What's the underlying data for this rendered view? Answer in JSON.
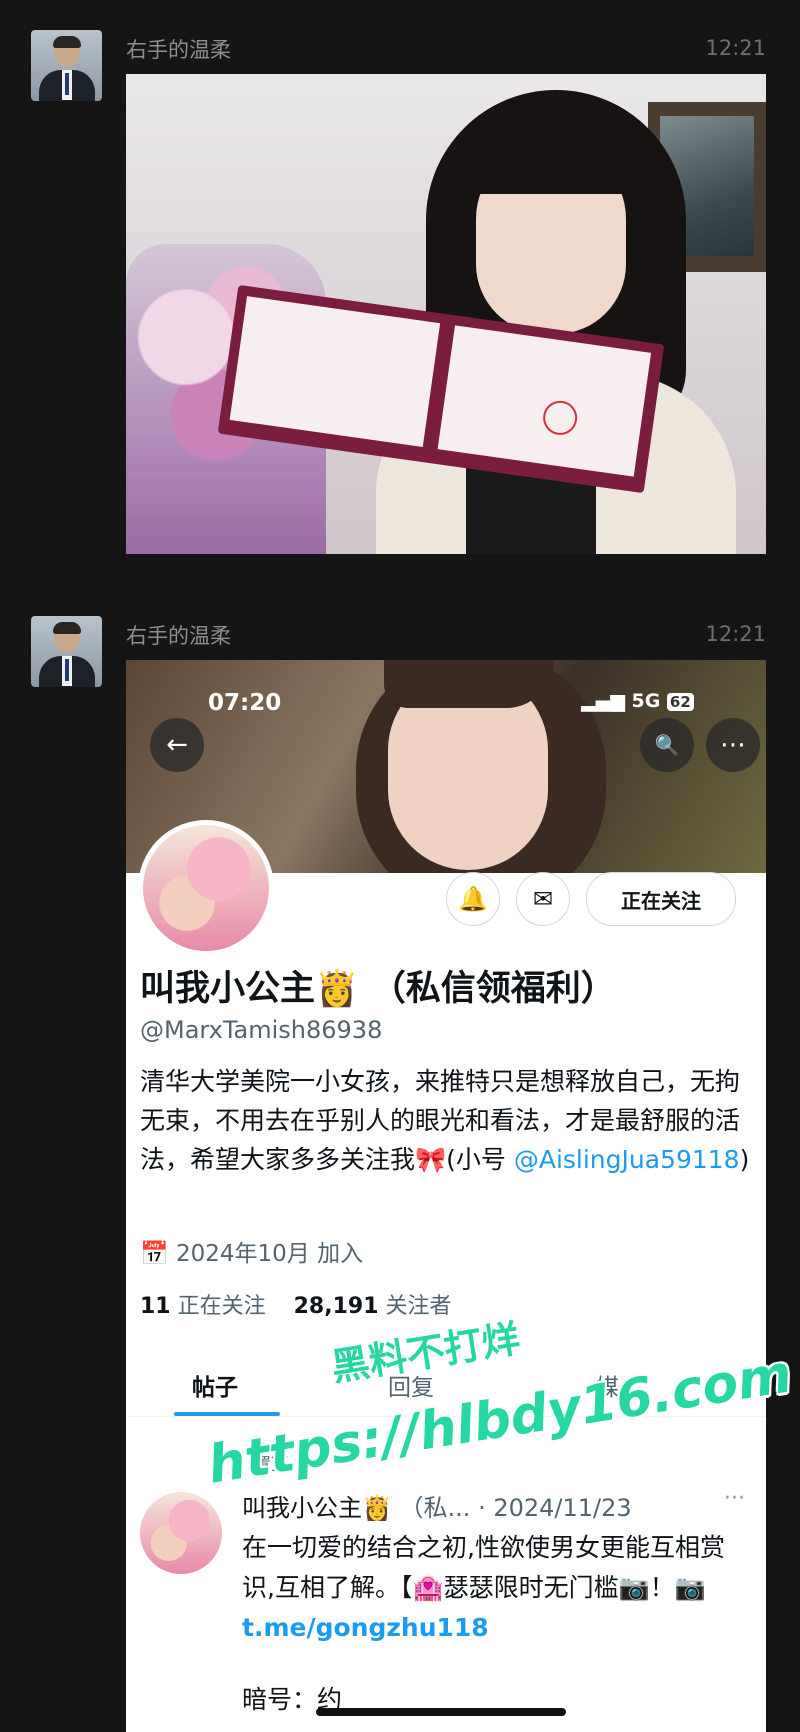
{
  "messages": [
    {
      "sender": "右手的温柔",
      "time": "12:21"
    },
    {
      "sender": "右手的温柔",
      "time": "12:21"
    }
  ],
  "profile_screenshot": {
    "status_bar": {
      "time": "07:20",
      "signal": "5G",
      "battery": "62"
    },
    "icons": {
      "back": "←",
      "search": "🔍",
      "more": "⋯",
      "notify": "🔔",
      "mail": "✉"
    },
    "follow_button": "正在关注",
    "display_name": "叫我小公主👸 （私信领福利）",
    "handle": "@MarxTamish86938",
    "bio_text": "清华大学美院一小女孩，来推特只是想释放自己，无拘无束，不用去在乎别人的眼光和看法，才是最舒服的活法，希望大家多多关注我🎀(小号 ",
    "bio_link": "@AislingJua59118",
    "bio_end": ")",
    "joined": "2024年10月 加入",
    "following_count": "11",
    "following_label": "正在关注",
    "followers_count": "28,191",
    "followers_label": "关注者",
    "tabs": [
      "帖子",
      "回复",
      "媒"
    ],
    "pinned_label": "置顶",
    "post": {
      "author": "叫我小公主👸",
      "author_suffix": "（私...",
      "dot_date": "· 2024/11/23",
      "more": "···",
      "text": "在一切爱的结合之初,性欲使男女更能互相赏识,互相了解。【🏩瑟瑟限时无门槛📷！📷",
      "link": "t.me/gongzhu118",
      "tail": "暗号：约"
    }
  },
  "watermark": {
    "line1": "黑料不打烊",
    "line2": "https://hlbdy16.com"
  }
}
